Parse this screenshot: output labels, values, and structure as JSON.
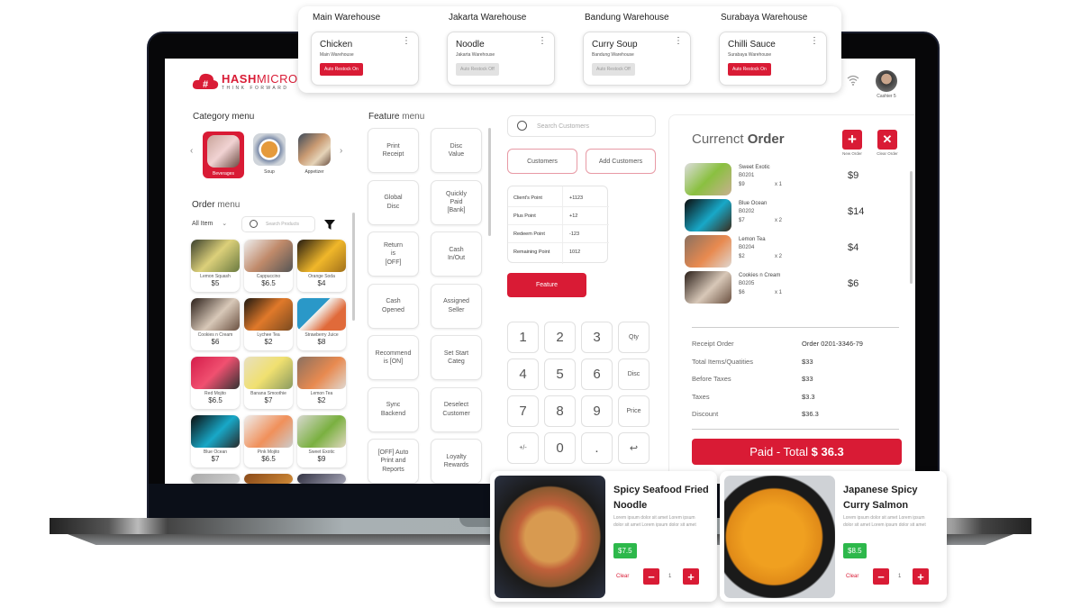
{
  "warehouses": [
    {
      "title": "Main Warehouse",
      "item": "Chicken",
      "location": "Main Warehouse",
      "restock": "Auto Restock On",
      "on": true
    },
    {
      "title": "Jakarta Warehouse",
      "item": "Noodle",
      "location": "Jakarta Warehouse",
      "restock": "Auto Restock Off",
      "on": false
    },
    {
      "title": "Bandung Warehouse",
      "item": "Curry Soup",
      "location": "Bandung Warehouse",
      "restock": "Auto Restock Off",
      "on": false
    },
    {
      "title": "Surabaya Warehouse",
      "item": "Chilli Sauce",
      "location": "Surabaya Warehouse",
      "restock": "Auto Restock On",
      "on": true
    }
  ],
  "brand": {
    "name_bold": "HASH",
    "name_rest": "MICRO",
    "tagline": "THINK FORWARD"
  },
  "user": {
    "name": "Cashier 5"
  },
  "category": {
    "title": "Category menu",
    "items": [
      {
        "label": "Beverages"
      },
      {
        "label": "Soup"
      },
      {
        "label": "Appetizer"
      }
    ]
  },
  "order_menu": {
    "title_bold": "Order",
    "title_rest": " menu",
    "filter": "All Item",
    "search_placeholder": "Search Products",
    "products": [
      {
        "name": "Lemon Squash",
        "price": "$5"
      },
      {
        "name": "Cappuccino",
        "price": "$6.5"
      },
      {
        "name": "Orange Soda",
        "price": "$4"
      },
      {
        "name": "Cookies n  Cream",
        "price": "$6"
      },
      {
        "name": "Lychee Tea",
        "price": "$2"
      },
      {
        "name": "Strawberry Juice",
        "price": "$8"
      },
      {
        "name": "Red Mojito",
        "price": "$6.5"
      },
      {
        "name": "Banana Smoothie",
        "price": "$7"
      },
      {
        "name": "Lemon Tea",
        "price": "$2"
      },
      {
        "name": "Blue Ocean",
        "price": "$7"
      },
      {
        "name": "Pink Mojito",
        "price": "$6.5"
      },
      {
        "name": "Sweet Exotic",
        "price": "$9"
      }
    ]
  },
  "feature_menu": {
    "title_bold": "Feature",
    "title_rest": " menu",
    "items": [
      "Print\nReceipt",
      "Disc\nValue",
      "Global\nDisc",
      "Quickly\nPaid\n[Bank]",
      "Return\nis\n[OFF]",
      "Cash\nIn/Out",
      "Cash\nOpened",
      "Assigned\nSeller",
      "Recommend\nis [ON]",
      "Set Start\nCateg",
      "Sync\nBackend",
      "Deselect\nCustomer",
      "[OFF] Auto\nPrint and\nReports",
      "Loyalty\nRewards"
    ]
  },
  "customers": {
    "search_placeholder": "Search Customers",
    "customers_btn": "Customers",
    "add_btn": "Add Customers",
    "points": [
      {
        "label": "Client's Point",
        "value": "+1123"
      },
      {
        "label": "Plus Point",
        "value": "+12"
      },
      {
        "label": "Redeem Point",
        "value": "-123"
      },
      {
        "label": "Remaining Point",
        "value": "1012"
      }
    ],
    "feature_btn": "Feature"
  },
  "keypad": [
    "1",
    "2",
    "3",
    "Qty",
    "4",
    "5",
    "6",
    "Disc",
    "7",
    "8",
    "9",
    "Price",
    "+/-",
    "0",
    ".",
    "↩"
  ],
  "current_order": {
    "title_light": "Currenct ",
    "title_bold": "Order",
    "new_label": "New Order",
    "clear_label": "Clear Order",
    "items": [
      {
        "name": "Sweet Exotic",
        "code": "B0201",
        "unit": "$9",
        "qty": "x 1",
        "total": "$9"
      },
      {
        "name": "Blue Ocean",
        "code": "B0202",
        "unit": "$7",
        "qty": "x 2",
        "total": "$14"
      },
      {
        "name": "Lemon Tea",
        "code": "B0204",
        "unit": "$2",
        "qty": "x 2",
        "total": "$4"
      },
      {
        "name": "Cookies n Cream",
        "code": "B0205",
        "unit": "$6",
        "qty": "x 1",
        "total": "$6"
      }
    ],
    "summary": [
      {
        "label": "Receipt Order",
        "value": "Order 0201-3346-79"
      },
      {
        "label": "Total Items/Quatities",
        "value": "$33"
      },
      {
        "label": "Before Taxes",
        "value": "$33"
      },
      {
        "label": "Taxes",
        "value": "$3.3"
      },
      {
        "label": "Discount",
        "value": "$36.3"
      }
    ],
    "pay_label": "Paid - Total ",
    "pay_total": "$ 36.3"
  },
  "dishes": [
    {
      "title": "Spicy Seafood Fried Noodle",
      "desc": "Lorem ipsum dolor sit amet Lorem ipsum dolor sit amet Lorem ipsum dolor sit amet",
      "price": "$7.5",
      "clear": "Clear",
      "qty": "1"
    },
    {
      "title": "Japanese Spicy Curry Salmon",
      "desc": "Lorem ipsum dolor sit amet Lorem ipsum dolor sit amet Lorem ipsum dolor sit amet",
      "price": "$8.5",
      "clear": "Clear",
      "qty": "1"
    }
  ],
  "colors": {
    "accent": "#d91b35",
    "price_green": "#2db84b"
  }
}
